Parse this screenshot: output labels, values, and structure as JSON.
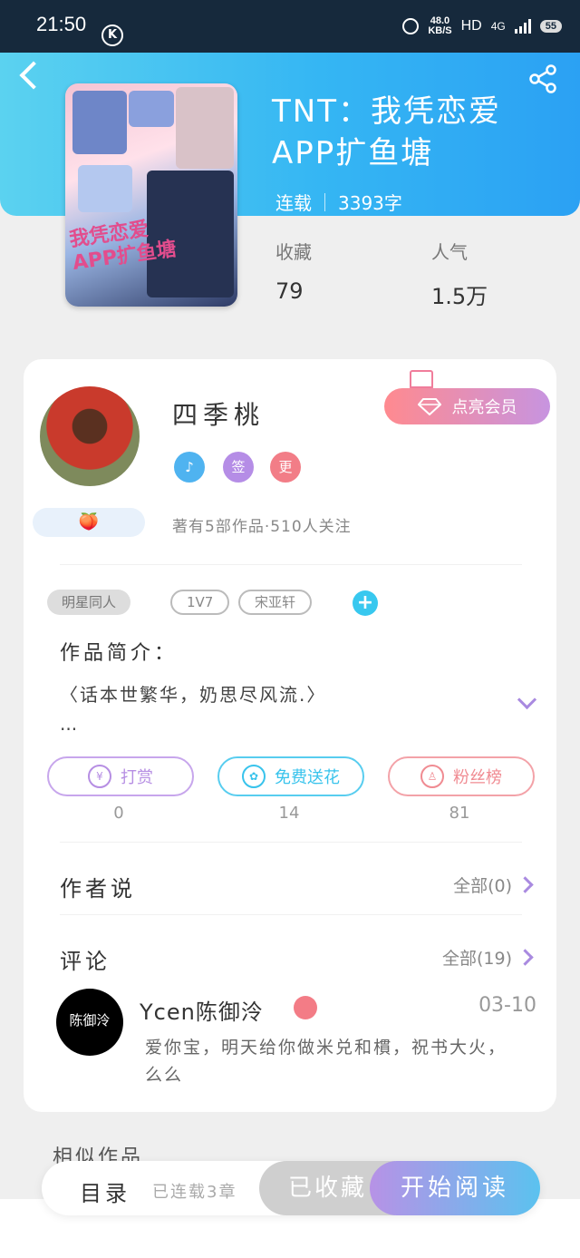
{
  "status_bar": {
    "time": "21:50",
    "k_icon": "K",
    "speed_value": "48.0",
    "speed_unit": "KB/S",
    "hd": "HD",
    "network": "4G",
    "battery": "55"
  },
  "book": {
    "title": "TNT：我凭恋爱APP扩鱼塘",
    "cover_text": "我凭恋爱APP扩鱼塘",
    "status": "连载",
    "word_count": "3393字",
    "favorites_label": "收藏",
    "favorites_value": "79",
    "popularity_label": "人气",
    "popularity_value": "1.5万"
  },
  "author": {
    "name": "四季桃",
    "badges": [
      "♪",
      "签",
      "更"
    ],
    "peach_emoji": "🍑",
    "meta": "著有5部作品·510人关注",
    "vip_button": "点亮会员"
  },
  "tags": [
    "明星同人",
    "1V7",
    "宋亚轩"
  ],
  "intro": {
    "label": "作品简介：",
    "text": "〈话本世繁华，奶思尽风流.〉",
    "more": "..."
  },
  "actions": [
    {
      "label": "打赏",
      "icon": "¥",
      "count": "0",
      "color": "#b68ee3"
    },
    {
      "label": "免费送花",
      "icon": "✿",
      "count": "14",
      "color": "#38c3ec"
    },
    {
      "label": "粉丝榜",
      "icon": "♙",
      "count": "81",
      "color": "#f08b92"
    }
  ],
  "author_says": {
    "label": "作者说",
    "right": "全部(0)"
  },
  "comments": {
    "label": "评论",
    "right": "全部(19)",
    "items": [
      {
        "avatar_text": "陈御泠",
        "name": "Ycen陈御泠",
        "date": "03-10",
        "text": "爱你宝，明天给你做米兑和樌，祝书大火，么么"
      }
    ]
  },
  "similar_label": "相似作品",
  "bottom": {
    "toc": "目录",
    "updated": "已连载3章",
    "collected": "已收藏",
    "read": "开始阅读"
  },
  "colors": {
    "header_start": "#5bd2f0",
    "header_end": "#2ba1f3",
    "accent_purple": "#b792e6",
    "accent_blue": "#5bc2ef"
  }
}
